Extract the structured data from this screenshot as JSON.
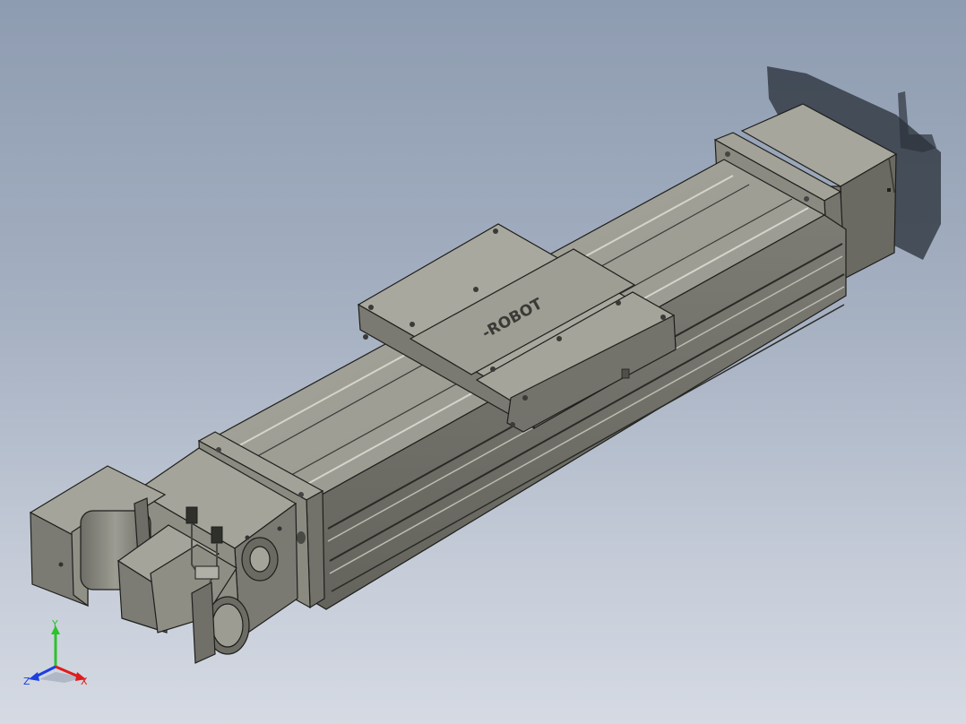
{
  "window": {
    "title": ""
  },
  "model": {
    "carriage_logo_text": "-ROBOT"
  },
  "triad": {
    "x_label": "X",
    "y_label": "Y",
    "z_label": "Z",
    "x_color": "#e01b1b",
    "y_color": "#2cc22c",
    "z_color": "#1b3fe0"
  },
  "colors": {
    "metal": "#8a8a80",
    "metal_light": "#a4a49a",
    "metal_dark": "#5c5c55",
    "edge": "#1e1e1c",
    "background_top": "#8e9cb1",
    "background_bottom": "#d5dae3"
  }
}
